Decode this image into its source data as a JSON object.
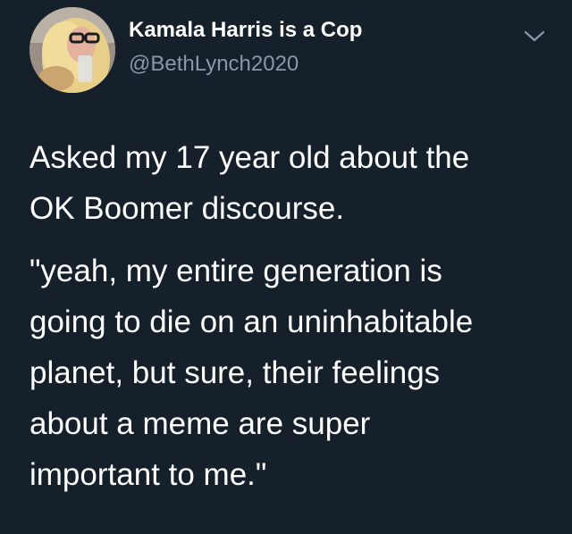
{
  "author": {
    "display_name": "Kamala Harris is a Cop",
    "handle": "@BethLynch2020",
    "avatar_icon": "user-avatar-photo"
  },
  "menu": {
    "icon": "chevron-down-icon"
  },
  "tweet": {
    "paragraph_1_line_1": "Asked my 17 year old about the",
    "paragraph_1_line_2": "OK Boomer discourse.",
    "paragraph_2_line_1": "\"yeah, my entire generation is",
    "paragraph_2_line_2": "going to die on an uninhabitable",
    "paragraph_2_line_3": "planet, but sure, their feelings",
    "paragraph_2_line_4": "about a meme are super",
    "paragraph_2_line_5": "important to me.\""
  },
  "colors": {
    "background": "#15202b",
    "primary_text": "#ffffff",
    "secondary_text": "#8899a6"
  }
}
